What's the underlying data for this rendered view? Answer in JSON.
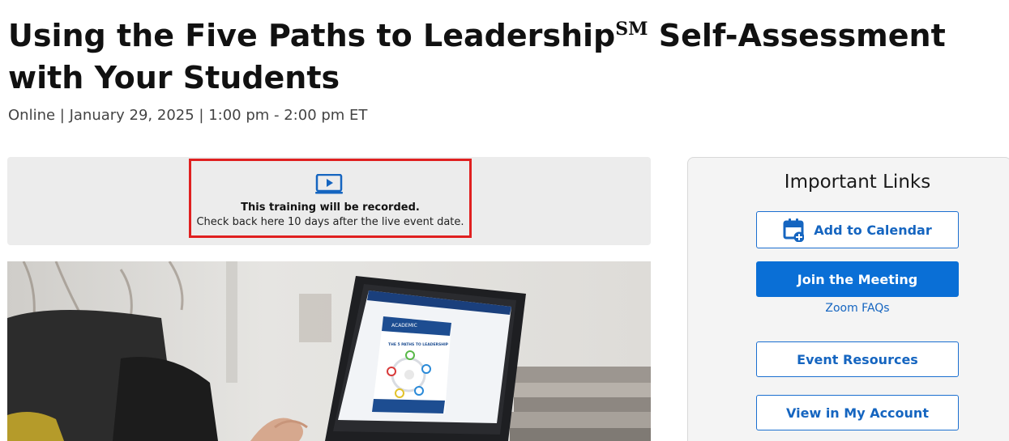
{
  "page": {
    "title_main": "Using the Five Paths to Leadership",
    "title_mark": "SM",
    "title_rest": " Self-Assessment with Your Students",
    "meta": "Online | January 29, 2025 | 1:00 pm - 2:00 pm ET"
  },
  "notice": {
    "icon": "video-play-icon",
    "bold": "This training will be recorded.",
    "text": "Check back here 10 days after the live event date."
  },
  "hero": {
    "screen_brand": "ACADEMIC",
    "screen_heading": "THE 5 PATHS TO LEADERSHIP"
  },
  "sidebar": {
    "title": "Important Links",
    "add_to_calendar": "Add to Calendar",
    "join_meeting": "Join the Meeting",
    "zoom_faqs": "Zoom FAQs",
    "event_resources": "Event Resources",
    "view_account": "View in My Account"
  },
  "colors": {
    "accent": "#0a6fd6",
    "link": "#1565c0",
    "highlight_border": "#e02020",
    "notice_bg": "#ececec"
  }
}
